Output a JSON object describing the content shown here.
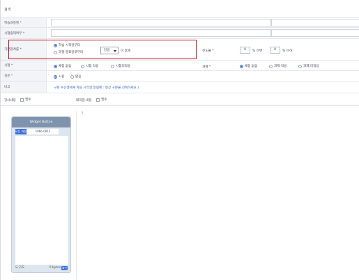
{
  "header": {
    "title": "검색"
  },
  "form": {
    "row1": {
      "label": "학습과정명 *",
      "value": ""
    },
    "row2": {
      "label": "시험출제여부 *",
      "value": ""
    },
    "row3": {
      "label": "기본합격률 *",
      "option1": "학습 시작일부터",
      "option2": "과정 종료일로부터",
      "select_value": "당일",
      "select_suffix": "이 후에",
      "right_label": "진도율 *",
      "right_input1": "0",
      "right_mid": "% 이면",
      "right_input2": "0",
      "right_suffix": "% 이하"
    },
    "row4": {
      "label": "시험 *",
      "opt1": "채점 없음",
      "opt2": "시험 적용",
      "opt3": "시험미적용",
      "right_label": "과제 *",
      "ropt1": "채점 없음",
      "ropt2": "과제 적용",
      "ropt3": "과제 미적용"
    },
    "row5": {
      "label": "설문 *",
      "opt1": "사용",
      "opt2": "없음"
    },
    "row6": {
      "label": "비고",
      "text": "구분 수강생에게 학습 시작일 알림메 : 항상 구분을 선택하세요.)"
    },
    "row7": {
      "left_text": "강사내용",
      "left_check": "필수",
      "mid_text": "대리점 내용",
      "mid_check": "필수"
    }
  },
  "panel": {
    "title": "Widget Button",
    "tab": "모든 과정",
    "field": "1066-0012",
    "footer_left": "도구/도",
    "footer_right": "0 bytes",
    "button": "확인"
  }
}
